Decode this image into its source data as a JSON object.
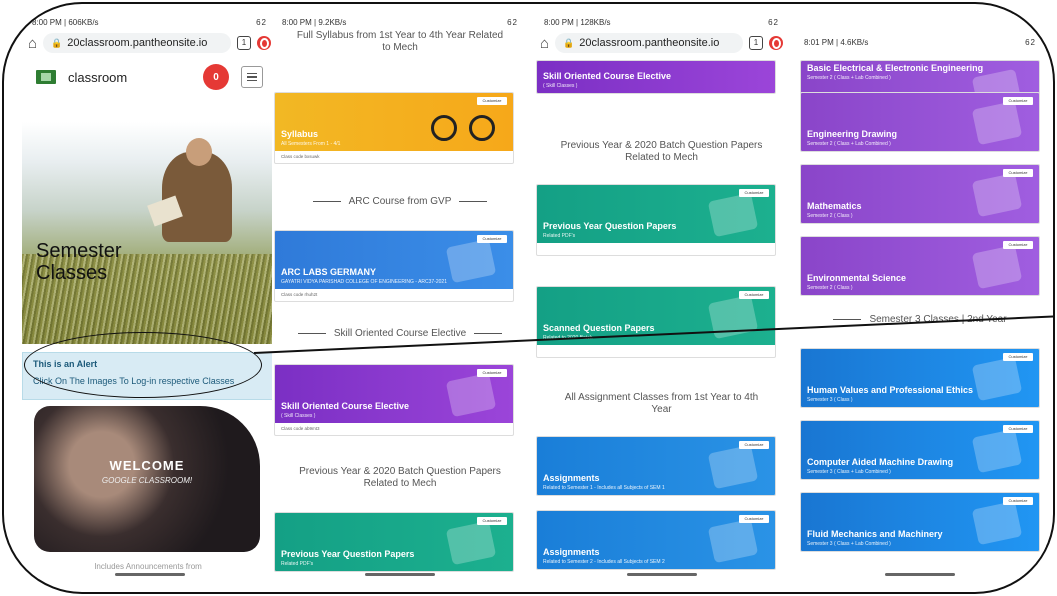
{
  "screen1": {
    "status_left": "8:00 PM | 606KB/s",
    "status_right": "62",
    "url": "20classroom.pantheonsite.io",
    "tabs_count": "1",
    "site_name": "classroom",
    "notification_count": "0",
    "hero_title": "Semester Classes",
    "alert_heading": "This is an Alert",
    "alert_text": "Click On The Images To Log-in respective Classes",
    "welcome_title": "WELCOME",
    "welcome_sub": "GOOGLE CLASSROOM!",
    "bottom_text": "Includes Announcements from"
  },
  "screen2": {
    "status_left": "8:00 PM | 9.2KB/s",
    "status_right": "62",
    "heading_top": "Full Syllabus from 1st Year to 4th Year Related to Mech",
    "syllabus_title": "Syllabus",
    "syllabus_sub": "All Semesters From 1 - 4/1",
    "syllabus_meta": "Class code  bxsuwk",
    "divider_arc": "ARC Course from GVP",
    "arc_title": "ARC LABS GERMANY",
    "arc_sub": "GAYATRI VIDYA PARISHAD COLLEGE OF ENGINEERING - ARC37-2021",
    "arc_meta": "Class code  rhuh2t",
    "divider_skill": "Skill Oriented Course Elective",
    "skill_title": "Skill Oriented Course Elective",
    "skill_sub": "( Skill Classes )",
    "skill_meta": "Class code  ab9mt3",
    "heading_prev": "Previous Year & 2020 Batch Question Papers Related to Mech",
    "prev_title": "Previous Year Question Papers",
    "prev_sub": "Related PDF's",
    "customize": "Customize"
  },
  "screen3": {
    "status_left": "8:00 PM | 128KB/s",
    "status_right": "62",
    "url": "20classroom.pantheonsite.io",
    "tabs_count": "1",
    "skill_title": "Skill Oriented Course Elective",
    "skill_sub": "( Skill Classes )",
    "heading_prev": "Previous Year & 2020 Batch Question Papers Related to Mech",
    "prev_title": "Previous Year Question Papers",
    "prev_sub": "Related PDF's",
    "scanned_title": "Scanned Question Papers",
    "scanned_sub": "Related to 2020 Batch",
    "heading_assign": "All Assignment Classes from 1st Year to 4th Year",
    "assign1_title": "Assignments",
    "assign1_sub": "Related to Semester 1 - Includes all Subjects of SEM 1",
    "assign2_title": "Assignments",
    "assign2_sub": "Related to Semester 2 - Includes all Subjects of SEM 2"
  },
  "screen4": {
    "status_left": "8:01 PM | 4.6KB/s",
    "status_right": "62",
    "c1_title": "Basic Electrical & Electronic Engineering",
    "c1_sub": "Semester 2 ( Class + Lab Combined )",
    "c2_title": "Engineering Drawing",
    "c2_sub": "Semester 2 ( Class + Lab Combined )",
    "c3_title": "Mathematics",
    "c3_sub": "Semester 2 ( Class )",
    "c4_title": "Environmental Science",
    "c4_sub": "Semester 2 ( Class )",
    "divider_sem3": "Semester 3 Classes | 2nd Year",
    "c5_title": "Human Values and Professional Ethics",
    "c5_sub": "Semester 3 ( Class )",
    "c6_title": "Computer Aided Machine Drawing",
    "c6_sub": "Semester 3 ( Class + Lab Combined )",
    "c7_title": "Fluid Mechanics and Machinery",
    "c7_sub": "Semester 3 ( Class + Lab Combined )"
  },
  "colors": {
    "alert_bg": "#d8ebf4",
    "badge": "#e53935",
    "orange": "#f2b824",
    "blue": "#2f7ad9",
    "purple": "#7b2fc4",
    "teal": "#14a085"
  },
  "icons": [
    "home-icon",
    "lock-icon",
    "tabs-icon",
    "opera-icon",
    "menu-icon",
    "logo-icon"
  ]
}
